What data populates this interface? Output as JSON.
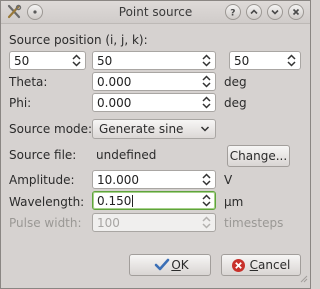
{
  "window": {
    "title": "Point source",
    "app_icon": "tools-icon",
    "controls": [
      "menu-circle-icon",
      "help-icon",
      "shade-up-icon",
      "maximize-down-icon",
      "close-icon"
    ]
  },
  "source_position": {
    "label": "Source position (i, j, k):",
    "i": "50",
    "j": "50",
    "k": "50"
  },
  "theta": {
    "label": "Theta:",
    "value": "0.000",
    "unit": "deg"
  },
  "phi": {
    "label": "Phi:",
    "value": "0.000",
    "unit": "deg"
  },
  "source_mode": {
    "label": "Source mode:",
    "selected": "Generate sine"
  },
  "source_file": {
    "label": "Source file:",
    "value": "undefined",
    "button": "Change..."
  },
  "amplitude": {
    "label": "Amplitude:",
    "value": "10.000",
    "unit": "V"
  },
  "wavelength": {
    "label": "Wavelength:",
    "value": "0.150",
    "unit": "µm"
  },
  "pulse_width": {
    "label": "Pulse width:",
    "value": "100",
    "unit": "timesteps"
  },
  "buttons": {
    "ok_prefix": "",
    "ok_mnemonic": "O",
    "ok_rest": "K",
    "cancel_mnemonic": "C",
    "cancel_rest": "ancel"
  },
  "colors": {
    "focus_border": "#5fa33c",
    "ok_icon": "#3b6fb6",
    "cancel_icon": "#c8312b"
  }
}
